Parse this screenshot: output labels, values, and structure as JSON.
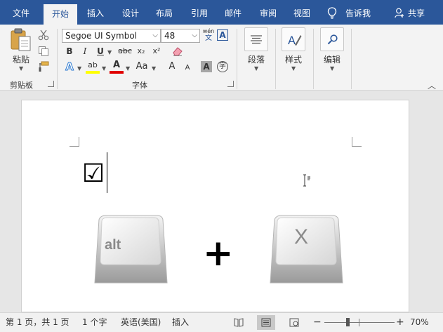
{
  "tabs": [
    {
      "label": "文件",
      "active": false
    },
    {
      "label": "开始",
      "active": true
    },
    {
      "label": "插入",
      "active": false
    },
    {
      "label": "设计",
      "active": false
    },
    {
      "label": "布局",
      "active": false
    },
    {
      "label": "引用",
      "active": false
    },
    {
      "label": "邮件",
      "active": false
    },
    {
      "label": "审阅",
      "active": false
    },
    {
      "label": "视图",
      "active": false
    }
  ],
  "tell_me": "告诉我",
  "share": "共享",
  "ribbon": {
    "clipboard": {
      "paste": "粘贴",
      "group": "剪贴板"
    },
    "font": {
      "name": "Segoe UI Symbol",
      "size": "48",
      "group": "字体",
      "bold": "B",
      "italic": "I",
      "underline": "U",
      "strike": "abc",
      "subscript": "x₂",
      "superscript": "x²",
      "case": "Aa",
      "grow": "A",
      "shrink": "A",
      "phonetic_top": "wén",
      "phonetic_bottom": "文",
      "border_char": "A",
      "shade_char": "A",
      "enclose_char": "字",
      "effects": "A",
      "highlight": "ab",
      "font_color": "A"
    },
    "paragraph": {
      "label": "段落"
    },
    "styles": {
      "label": "样式"
    },
    "editing": {
      "label": "编辑"
    }
  },
  "document": {
    "checkbox_char": "☑",
    "key1_label": "alt",
    "plus": "+",
    "key2_label": "X"
  },
  "status": {
    "page": "第 1 页，共 1 页",
    "words": "1 个字",
    "language": "英语(美国)",
    "mode": "插入",
    "zoom": "70%",
    "zoom_level": 0.7
  },
  "colors": {
    "accent": "#2b579a",
    "highlight": "#ffff00",
    "font_color": "#e00000"
  }
}
